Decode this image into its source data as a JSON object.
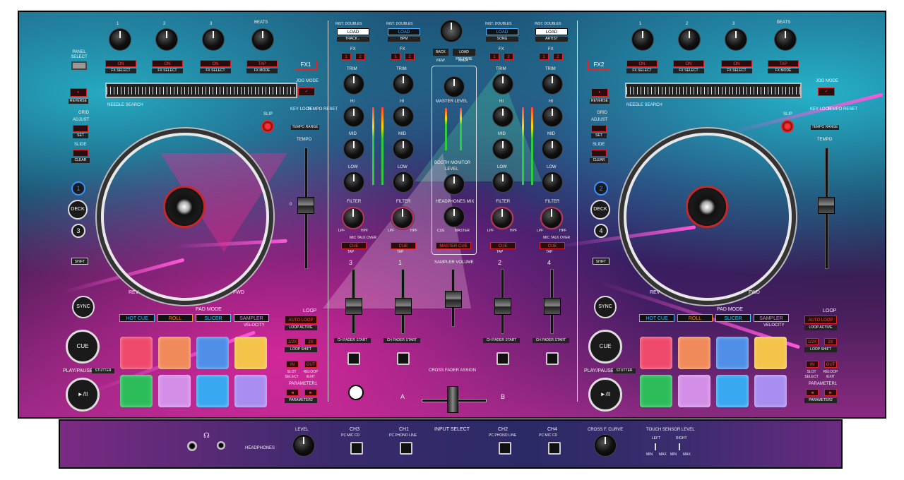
{
  "colors": {
    "accent_red": "#e22222",
    "cyan": "#28d2e6",
    "magenta": "#e628a0",
    "deep": "#1a1f45"
  },
  "left_deck": {
    "fx_knob_labels": [
      "1",
      "2",
      "3",
      "BEATS"
    ],
    "fx_on": [
      "ON",
      "ON",
      "ON",
      "TAP"
    ],
    "fx_sub": [
      "FX SELECT",
      "FX SELECT",
      "FX SELECT",
      "FX MODE"
    ],
    "fx_badge": "FX1",
    "panel_select": "PANEL SELECT",
    "reverse": "REVERSE",
    "needle_search": "NEEDLE SEARCH",
    "jog_mode": "JOG MODE",
    "key_lock": "KEY LOCK",
    "tempo_reset": "TEMPO RESET",
    "tempo_range": "TEMPO RANGE",
    "slip": "SLIP",
    "grid": "GRID",
    "adjust": "ADJUST",
    "set": "SET",
    "slide": "SLIDE",
    "clear": "CLEAR",
    "deck": "DECK",
    "deck_num_a": "1",
    "deck_num_b": "3",
    "shift": "SHIFT",
    "tempo": "TEMPO",
    "rev": "REV",
    "fwd": "FWD",
    "sync": "SYNC",
    "cue": "CUE",
    "play_pause": "PLAY/PAUSE",
    "stutter": "STUTTER",
    "pad_mode": "PAD MODE",
    "pad_modes": [
      "HOT CUE",
      "ROLL",
      "SLICER",
      "SAMPLER"
    ],
    "pad_mode_nums": [
      "1",
      "2",
      "3",
      "4"
    ],
    "velocity": "VELOCITY",
    "pad_colors": [
      "#ef4a6c",
      "#f08a5a",
      "#4f8fe8",
      "#f3c34a",
      "#2cbd5a",
      "#d38fe8",
      "#38a8f0",
      "#a88ef0"
    ],
    "loop": "LOOP",
    "auto_loop": "AUTO LOOP",
    "loop_active": "LOOP ACTIVE",
    "half_x": "1/2X",
    "two_x": "2X",
    "loop_shift": "LOOP SHIFT",
    "in": "IN",
    "out": "OUT",
    "slot_select": "SLOT SELECT",
    "reloop_exit": "RELOOP /EXIT",
    "parameter1": "PARAMETER1",
    "parameter2": "PARAMETER2",
    "zero": "0"
  },
  "right_deck": {
    "fx_knob_labels": [
      "1",
      "2",
      "3",
      "BEATS"
    ],
    "fx_on": [
      "ON",
      "ON",
      "ON",
      "TAP"
    ],
    "fx_sub": [
      "FX SELECT",
      "FX SELECT",
      "FX SELECT",
      "FX MODE"
    ],
    "fx_badge": "FX2",
    "deck_num_a": "2",
    "deck_num_b": "4"
  },
  "mixer": {
    "ch_top": [
      {
        "inst": "INST. DOUBLES",
        "load": "LOAD",
        "sub": "TRACK←"
      },
      {
        "inst": "INST. DOUBLES",
        "load": "LOAD",
        "sub": "BPM"
      },
      {
        "inst": "INST. DOUBLES",
        "load": "LOAD",
        "sub": "SONG"
      },
      {
        "inst": "INST. DOUBLES",
        "load": "LOAD",
        "sub": "ARTIST"
      }
    ],
    "fx": "FX",
    "fx_btns": [
      "1",
      "2"
    ],
    "trim": "TRIM",
    "hi": "HI",
    "mid": "MID",
    "low": "LOW",
    "filter": "FILTER",
    "lpf": "LPF",
    "hpf": "HPF",
    "cue": "CUE",
    "tap": "TAP",
    "mic_talk_over": "MIC TALK OVER",
    "ch_nums": [
      "3",
      "1",
      "2",
      "4"
    ],
    "ch_fader_start": "CH FADER START",
    "thru_a": "A",
    "thru": "THRU",
    "thru_b": "B",
    "back": "BACK",
    "load_prepare": "LOAD PREPARE",
    "view": "VIEW",
    "area": "AREA",
    "master_level": "MASTER LEVEL",
    "booth_monitor": "BOOTH MONITOR",
    "level": "LEVEL",
    "headphones_mix": "HEADPHONES MIX",
    "master": "MASTER",
    "master_cue": "MASTER CUE",
    "sampler_volume": "SAMPLER VOLUME",
    "cross_fader_assign": "CROSS FADER ASSIGN",
    "xf_a": "A",
    "xf_b": "B"
  },
  "front_panel": {
    "headphones": "HEADPHONES",
    "level": "LEVEL",
    "input_select": "INPUT SELECT",
    "ch3": "CH3",
    "ch1": "CH1",
    "ch2": "CH2",
    "ch4": "CH4",
    "ch3_sub": "PC   MIC   CD",
    "ch1_sub": "PC   PHONO  LINE",
    "ch2_sub": "PC   PHONO  LINE",
    "ch4_sub": "PC   MIC   CD",
    "cross_f_curve": "CROSS F. CURVE",
    "touch_sensor_level": "TOUCH SENSOR LEVEL",
    "left": "LEFT",
    "right": "RIGHT",
    "min": "MIN",
    "max": "MAX"
  }
}
